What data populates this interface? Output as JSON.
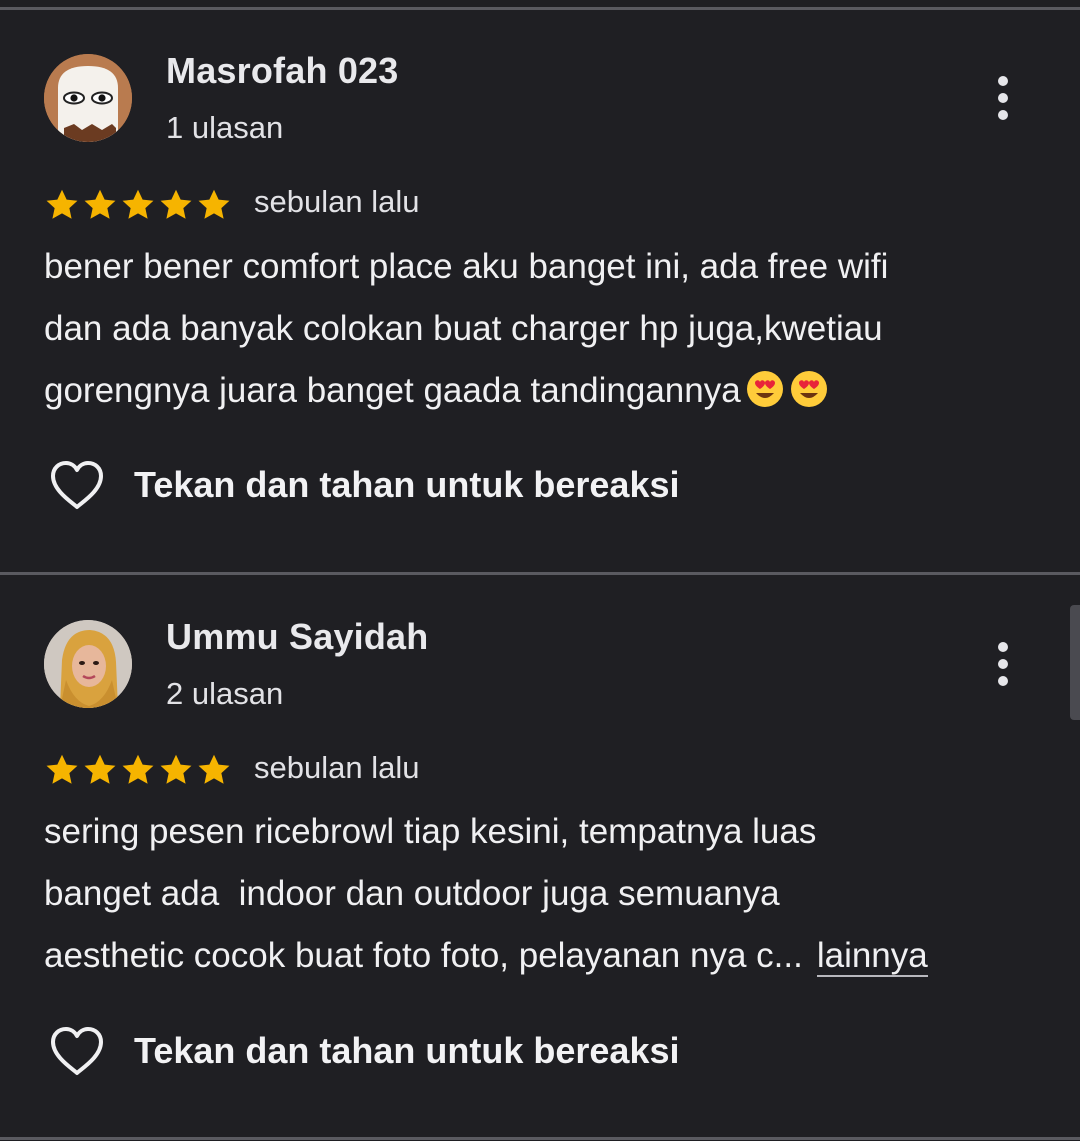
{
  "reviews": [
    {
      "author": "Masrofah 023",
      "review_count": "1 ulasan",
      "rating": 5,
      "time": "sebulan lalu",
      "text_lines": [
        "bener bener comfort place aku banget ini, ada free wifi",
        "dan ada banyak colokan buat charger hp juga,kwetiau",
        "gorengnya juara banget gaada tandingannya"
      ],
      "trailing_emojis": [
        "smiling-face-with-heart-eyes",
        "smiling-face-with-heart-eyes"
      ],
      "more_label": "",
      "react_label": "Tekan dan tahan untuk bereaksi"
    },
    {
      "author": "Ummu Sayidah",
      "review_count": "2 ulasan",
      "rating": 5,
      "time": "sebulan lalu",
      "text_lines": [
        "sering pesen ricebrowl tiap kesini, tempatnya luas",
        "banget ada  indoor dan outdoor juga semuanya",
        "aesthetic cocok buat foto foto, pelayanan nya c..."
      ],
      "trailing_emojis": [],
      "more_label": "lainnya",
      "react_label": "Tekan dan tahan untuk bereaksi"
    }
  ],
  "colors": {
    "background": "#1f1f23",
    "star": "#f6b400",
    "text": "#f0f0f2"
  }
}
